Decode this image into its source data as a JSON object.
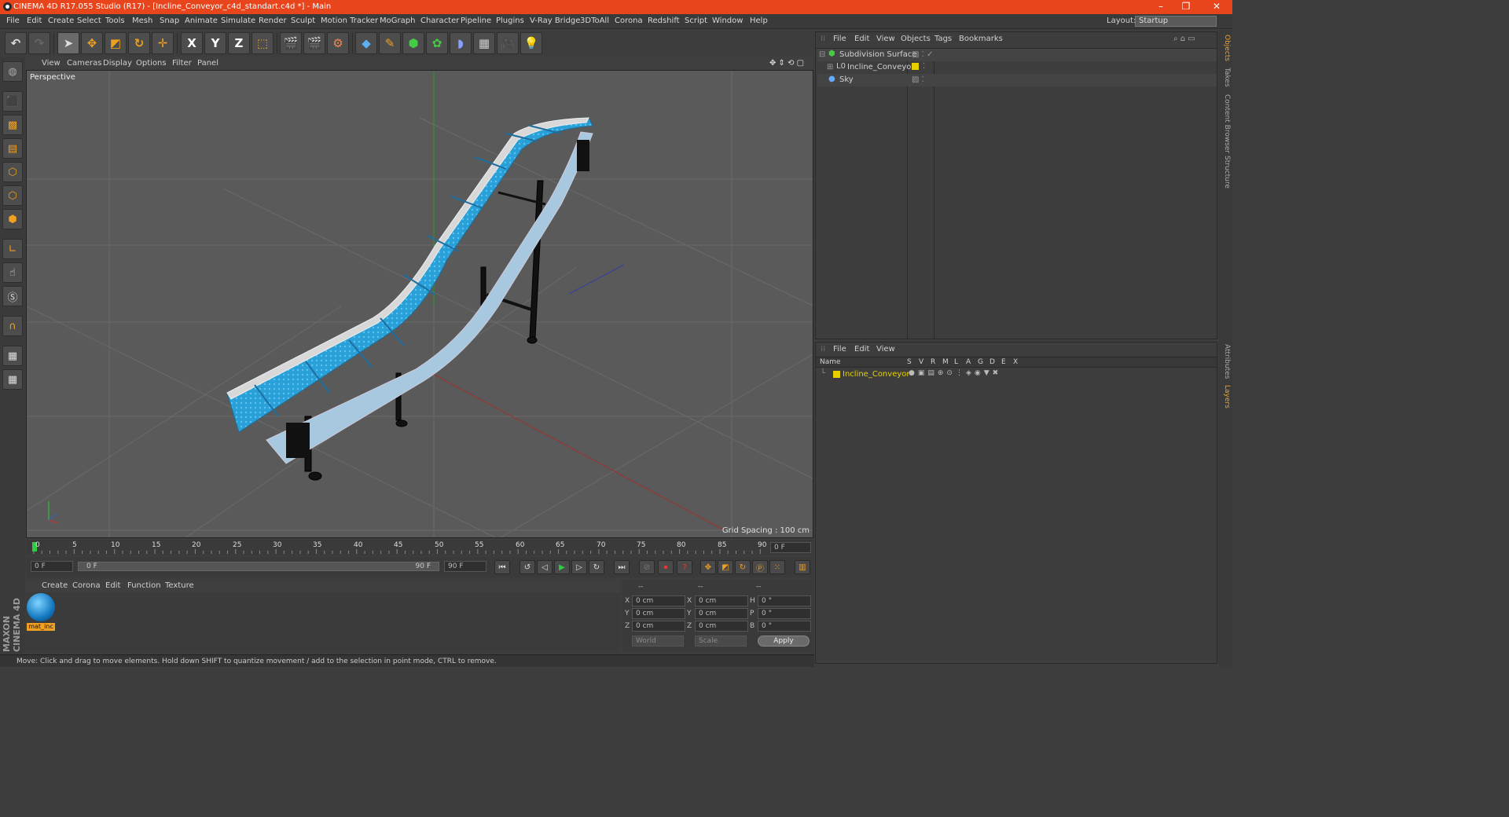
{
  "window": {
    "title": "CINEMA 4D R17.055 Studio (R17) - [Incline_Conveyor_c4d_standart.c4d *] - Main",
    "controls": [
      "–",
      "❐",
      "✕"
    ]
  },
  "menu": {
    "items": [
      "File",
      "Edit",
      "Create",
      "Select",
      "Tools",
      "Mesh",
      "Snap",
      "Animate",
      "Simulate",
      "Render",
      "Sculpt",
      "Motion Tracker",
      "MoGraph",
      "Character",
      "Pipeline",
      "Plugins",
      "V-Ray Bridge",
      "3DToAll",
      "Corona",
      "Redshift",
      "Script",
      "Window",
      "Help"
    ],
    "layout_label": "Layout:",
    "layout_value": "Startup"
  },
  "toolbar": {
    "axis_x": "X",
    "axis_y": "Y",
    "axis_z": "Z"
  },
  "viewport": {
    "menu": [
      "View",
      "Cameras",
      "Display",
      "Options",
      "Filter",
      "Panel"
    ],
    "camera_label": "Perspective",
    "grid_spacing": "Grid Spacing : 100 cm"
  },
  "timeline": {
    "ticks": [
      "0",
      "5",
      "10",
      "15",
      "20",
      "25",
      "30",
      "35",
      "40",
      "45",
      "50",
      "55",
      "60",
      "65",
      "70",
      "75",
      "80",
      "85",
      "90"
    ],
    "current_frame": "0 F",
    "start_field": "0 F",
    "range_start": "0 F",
    "range_end": "90 F",
    "end_field": "90 F"
  },
  "materials": {
    "menu": [
      "Create",
      "Corona",
      "Edit",
      "Function",
      "Texture"
    ],
    "items": [
      {
        "name": "mat_inc"
      }
    ]
  },
  "coordinates": {
    "headers": [
      "--",
      "--",
      "--"
    ],
    "rows": [
      {
        "a": "X",
        "av": "0 cm",
        "b": "X",
        "bv": "0 cm",
        "c": "H",
        "cv": "0 °"
      },
      {
        "a": "Y",
        "av": "0 cm",
        "b": "Y",
        "bv": "0 cm",
        "c": "P",
        "cv": "0 °"
      },
      {
        "a": "Z",
        "av": "0 cm",
        "b": "Z",
        "bv": "0 cm",
        "c": "B",
        "cv": "0 °"
      }
    ],
    "mode1": "World",
    "mode2": "Scale",
    "apply": "Apply"
  },
  "objects": {
    "menu": [
      "File",
      "Edit",
      "View",
      "Objects",
      "Tags",
      "Bookmarks"
    ],
    "items": [
      {
        "name": "Subdivision Surface"
      },
      {
        "name": "Incline_Conveyor"
      },
      {
        "name": "Sky"
      }
    ]
  },
  "layers": {
    "menu": [
      "File",
      "Edit",
      "View"
    ],
    "name_header": "Name",
    "cols": [
      "S",
      "V",
      "R",
      "M",
      "L",
      "A",
      "G",
      "D",
      "E",
      "X"
    ],
    "items": [
      {
        "name": "Incline_Conveyor"
      }
    ]
  },
  "side_tabs": [
    "Objects",
    "Takes",
    "Content Browser",
    "Structure",
    "Attributes",
    "Layers"
  ],
  "brand": "MAXON CINEMA 4D",
  "status": "Move: Click and drag to move elements. Hold down SHIFT to quantize movement / add to the selection in point mode, CTRL to remove.",
  "colors": {
    "titlebar": "#e8451d",
    "belt": "#2aa0d8",
    "layer_yellow": "#e8d000"
  }
}
